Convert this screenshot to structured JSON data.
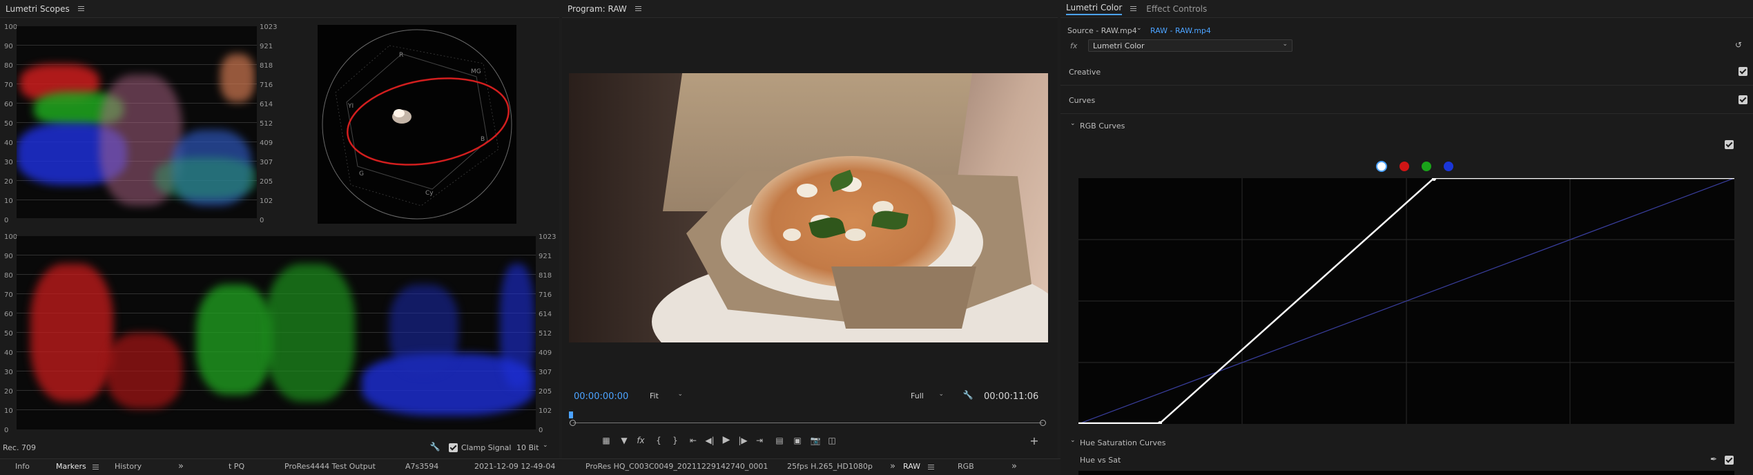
{
  "scopes": {
    "tab_title": "Lumetri Scopes",
    "left_scale": [
      "100",
      "90",
      "80",
      "70",
      "60",
      "50",
      "40",
      "30",
      "20",
      "10",
      "0"
    ],
    "right_scale": [
      "1023",
      "921",
      "818",
      "716",
      "614",
      "512",
      "409",
      "307",
      "205",
      "102",
      "0"
    ],
    "vectorscope_labels": [
      "R",
      "MG",
      "B",
      "Cy",
      "G",
      "YI"
    ],
    "footer_left": "Rec. 709",
    "clamp_signal_label": "Clamp Signal",
    "clamp_signal_checked": true,
    "bit_depth": "10 Bit"
  },
  "program": {
    "tab_title": "Program: RAW",
    "timecode_current": "00:00:00:00",
    "zoom": "Fit",
    "resolution": "Full",
    "timecode_duration": "00:00:11:06",
    "transport_buttons": [
      "marker-add-icon",
      "marker-icon",
      "fx-icon",
      "in-point-icon",
      "out-point-icon",
      "go-to-in-icon",
      "step-back-icon",
      "play-icon",
      "step-forward-icon",
      "go-to-out-icon",
      "lift-icon",
      "extract-icon",
      "export-frame-icon",
      "compare-icon",
      "add-button-icon"
    ]
  },
  "lumetri": {
    "tabs": [
      "Lumetri Color",
      "Effect Controls"
    ],
    "source": "Source - RAW.mp4",
    "target": "RAW - RAW.mp4",
    "fx_label": "fx",
    "effect_name": "Lumetri Color",
    "sections": [
      "Creative",
      "Curves"
    ],
    "rgb_curves_label": "RGB Curves",
    "channel_colors": [
      "#ffffff",
      "#d01515",
      "#1aa31a",
      "#1a36d8"
    ],
    "hue_sat_label": "Hue Saturation Curves",
    "hue_vs_sat_label": "Hue vs Sat"
  },
  "bottom_bar": {
    "tabs": [
      "Info",
      "Markers",
      "History"
    ],
    "overflow": "»",
    "columns": [
      "t PQ",
      "ProRes4444 Test Output",
      "A7s3594",
      "2021-12-09 12-49-04",
      "ProRes HQ_C003C0049_20211229142740_0001",
      "25fps H.265_HD1080p"
    ],
    "right_tabs": [
      "RAW",
      "RGB"
    ]
  }
}
